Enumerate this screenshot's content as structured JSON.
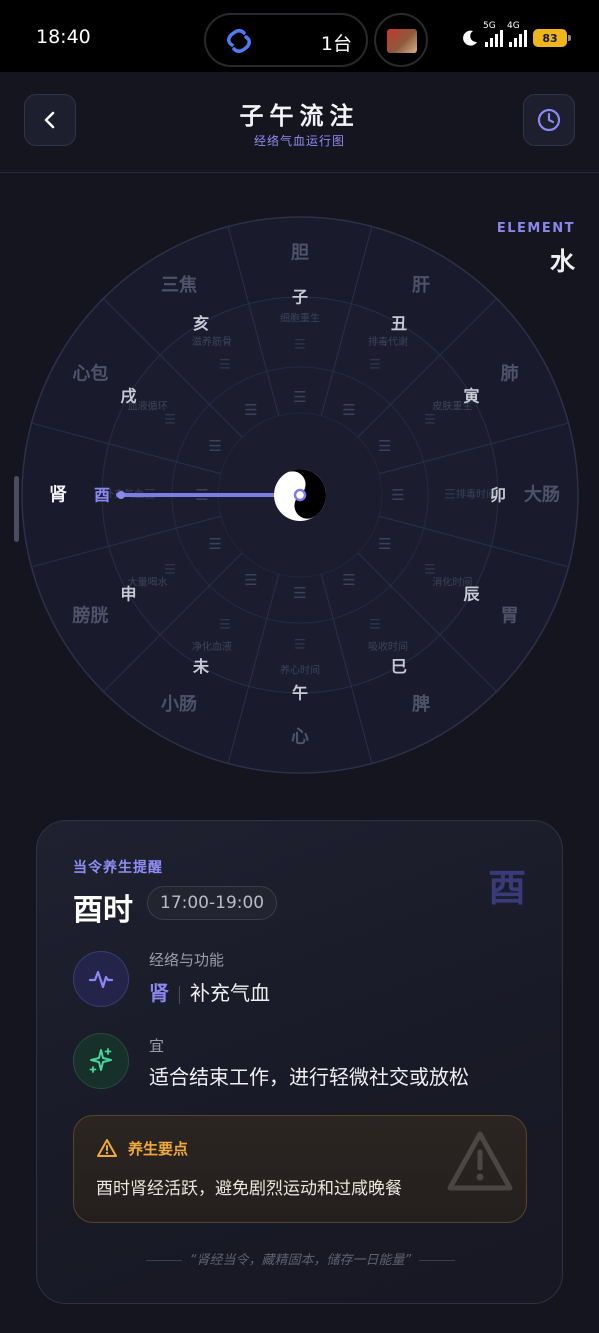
{
  "status_bar": {
    "time": "18:40",
    "island_text": "1台",
    "net1": "5G",
    "net2": "4G",
    "battery": "83"
  },
  "header": {
    "title": "子午流注",
    "subtitle": "经络气血运行图"
  },
  "element": {
    "label": "ELEMENT",
    "value": "水"
  },
  "wheel": {
    "branches": [
      "子",
      "丑",
      "寅",
      "卯",
      "辰",
      "巳",
      "午",
      "未",
      "申",
      "酉",
      "戌",
      "亥"
    ],
    "organs": [
      "胆",
      "肝",
      "肺",
      "大肠",
      "胃",
      "脾",
      "心",
      "小肠",
      "膀胱",
      "肾",
      "心包",
      "三焦"
    ],
    "functions": [
      "细胞重生",
      "排毒代谢",
      "皮肤重生",
      "排毒时间",
      "消化时间",
      "吸收时间",
      "养心时间",
      "净化血液",
      "大量喝水",
      "补充气血",
      "血液循环",
      "滋养筋骨"
    ],
    "active_branch": "酉",
    "active_organ": "肾"
  },
  "card": {
    "kicker": "当令养生提醒",
    "watermark": "酉",
    "title": "酉时",
    "time_range": "17:00-19:00",
    "meridian_label": "经络与功能",
    "meridian": "肾",
    "function": "补充气血",
    "suitable_label": "宜",
    "suitable_text": "适合结束工作，进行轻微社交或放松",
    "tip_title": "养生要点",
    "tip_text": "酉时肾经活跃，避免剧烈运动和过咸晚餐",
    "quote": "“肾经当令，藏精固本，储存一日能量”"
  },
  "colors": {
    "accent": "#8b88f2",
    "warning": "#f0a93a",
    "green": "#4ad69a",
    "background": "#14151f"
  },
  "icons": {
    "back": "chevron-left-icon",
    "history": "clock-icon",
    "pulse": "pulse-icon",
    "sparkle": "sparkle-icon",
    "warning": "warning-icon",
    "center": "yin-yang-icon"
  }
}
